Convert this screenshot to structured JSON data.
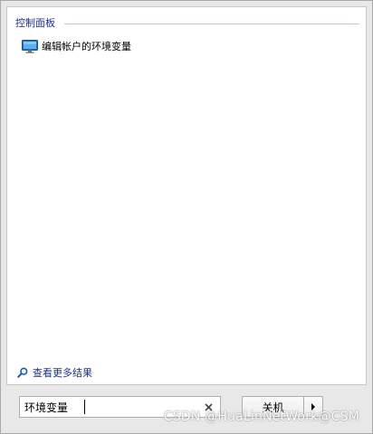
{
  "results": {
    "group_title": "控制面板",
    "items": [
      {
        "label": "编辑帐户的环境变量",
        "icon": "monitor-icon"
      }
    ],
    "see_more_label": "查看更多结果",
    "see_more_icon": "magnifier-icon"
  },
  "search": {
    "value": "环境变量",
    "clear_icon": "close-icon"
  },
  "power": {
    "shutdown_label": "关机",
    "arrow_icon": "triangle-right-icon"
  },
  "watermark": {
    "text": "CSDN @HuaLinNetWork@CSM"
  },
  "colors": {
    "accent_text": "#1e3287",
    "panel_bg": "#ffffff",
    "frame_bg": "#e8e8e8"
  }
}
